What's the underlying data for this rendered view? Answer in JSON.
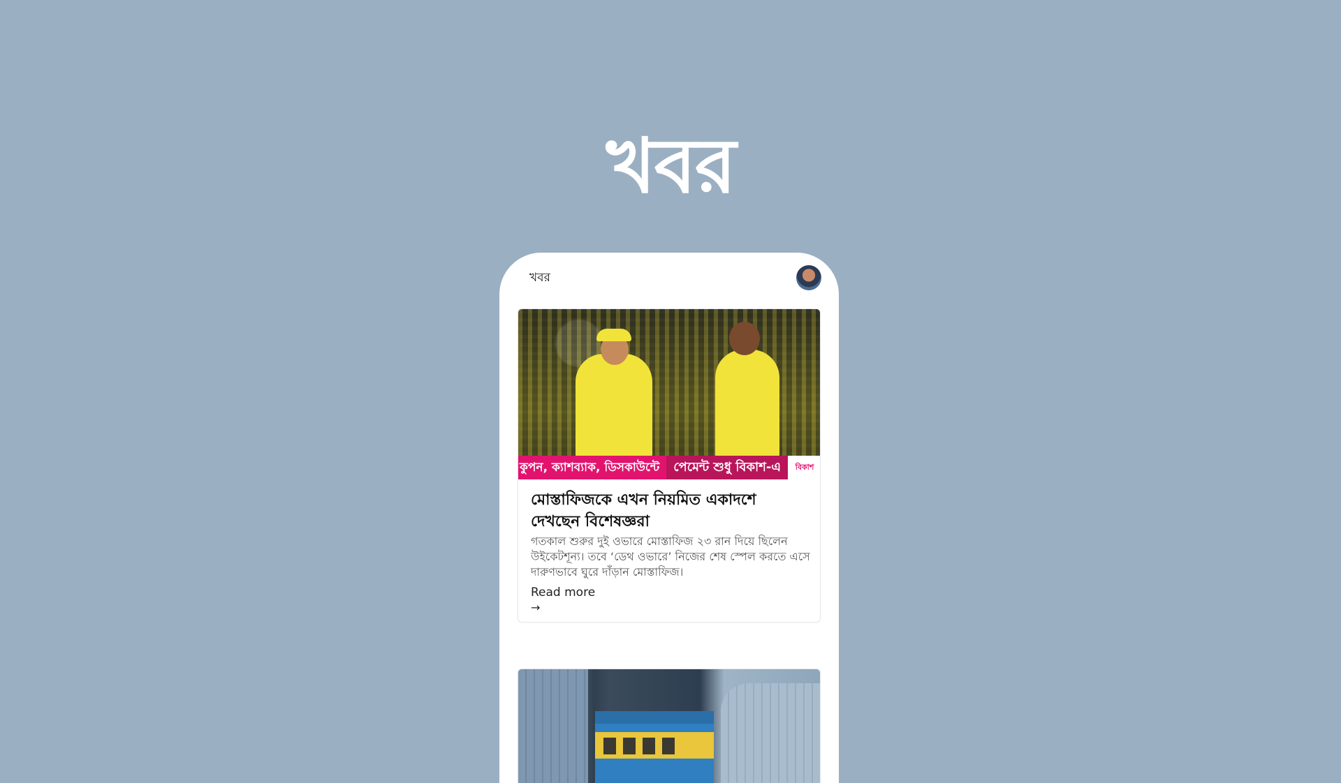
{
  "brand": {
    "title": "খবর"
  },
  "app": {
    "title": "খবর",
    "avatar_icon": "user-avatar"
  },
  "articles": [
    {
      "image": {
        "ad_strip": {
          "left_text": "কুপন, ক্যাশব্যাক, ডিসকাউন্টে",
          "mid_text": "পেমেন্ট শুধু বিকাশ-এ",
          "logo_text": "বিকাশ"
        }
      },
      "headline": "মোস্তাফিজকে এখন নিয়মিত একাদশে দেখছেন বিশেষজ্ঞরা",
      "excerpt": "গতকাল শুরুর দুই ওভারে মোস্তাফিজ ২৩ রান দিয়ে ছিলেন উইকেটশূন্য। তবে ‘ডেথ ওভারে’ নিজের শেষ স্পেল করতে এসে দারুণভাবে ঘুরে দাঁড়ান মোস্তাফিজ।",
      "read_more": "Read more",
      "arrow_icon": "arrow-right-icon"
    }
  ],
  "colors": {
    "background": "#9aafc2",
    "card": "#ffffff",
    "ad_pink": "#e2136e"
  }
}
